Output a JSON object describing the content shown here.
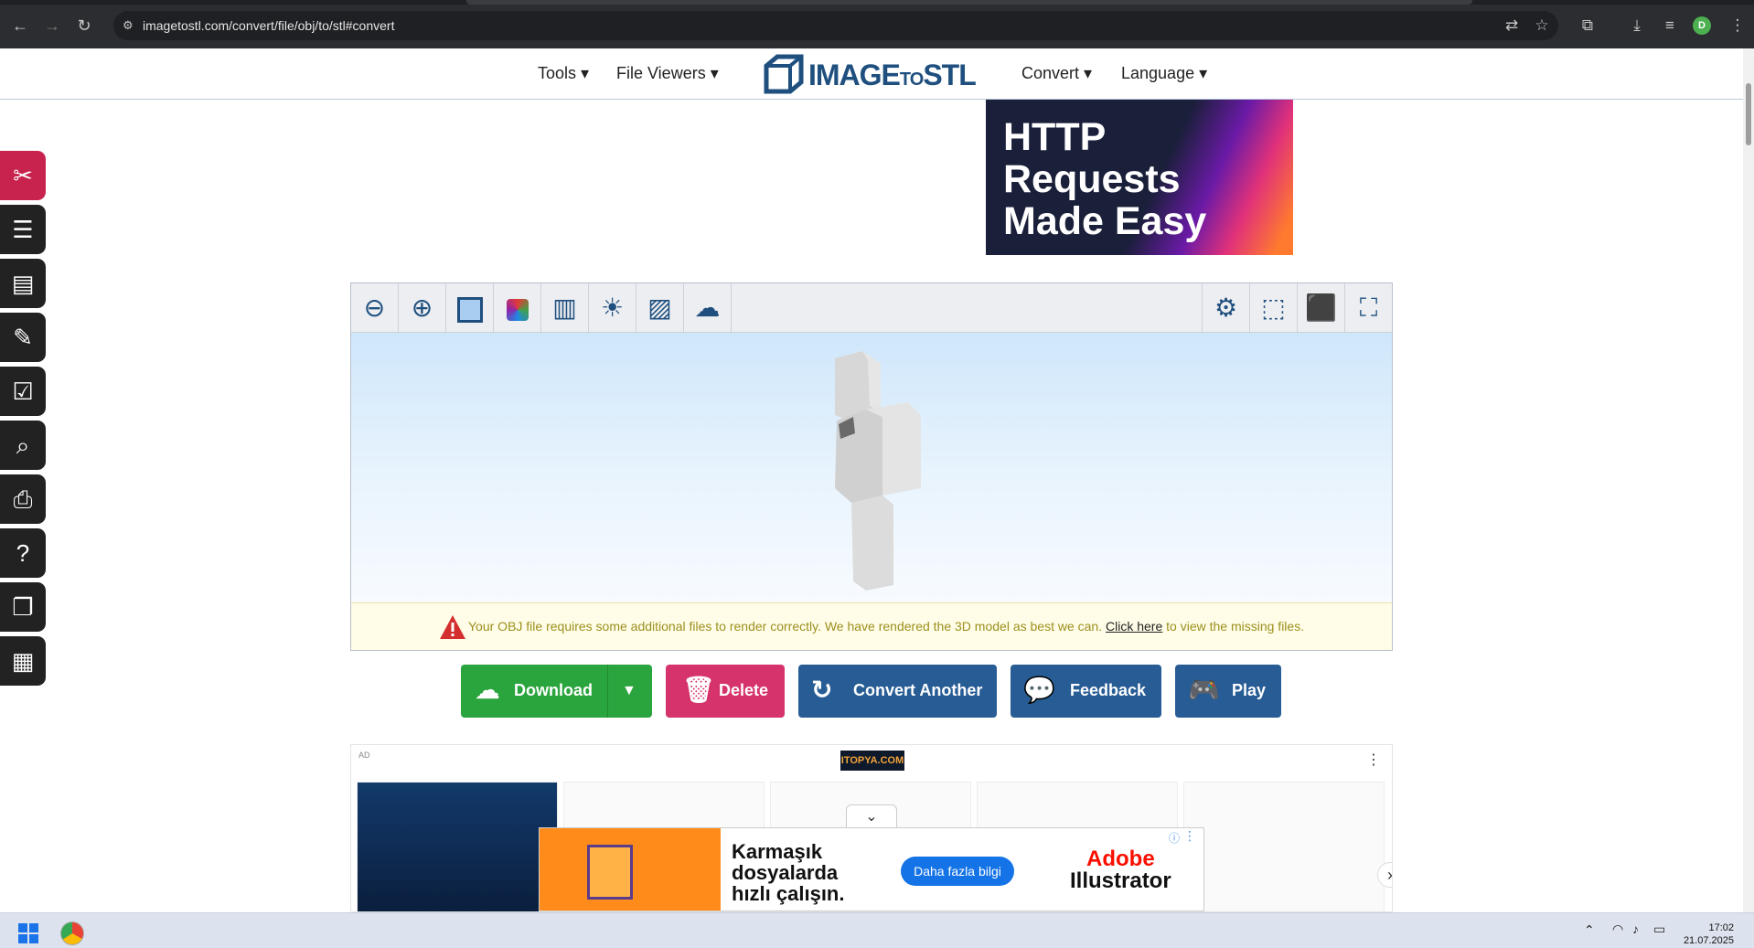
{
  "browser": {
    "url": "imagetostl.com/convert/file/obj/to/stl#convert",
    "profile_initial": "D"
  },
  "header": {
    "menu_tools": "Tools ▾",
    "menu_file_viewers": "File Viewers ▾",
    "logo_main": "IMAGE",
    "logo_small": "TO",
    "logo_end": "STL",
    "menu_convert": "Convert ▾",
    "menu_language": "Language ▾"
  },
  "hero_ad": {
    "text": "HTTP\nRequests\nMade Easy"
  },
  "viewer": {
    "warning_text": "Your OBJ file requires some additional files to render correctly. We have rendered the 3D model as best we can.",
    "warning_link": "Click here",
    "warning_tail": "to view the missing files."
  },
  "actions": {
    "download": "Download",
    "delete": "Delete",
    "convert_another": "Convert Another",
    "feedback": "Feedback",
    "play": "Play"
  },
  "ad": {
    "label": "AD",
    "brand": "ITOPYA.COM"
  },
  "overlay_ad": {
    "tagline": "Karmaşık\ndosyalarda\nhızlı çalışın.",
    "cta": "Daha fazla bilgi",
    "brand_line1": "Adobe",
    "brand_line2": "Illustrator"
  },
  "taskbar": {
    "time": "17:02",
    "date": "21.07.2025"
  },
  "colors": {
    "accent": "#1f4f7f",
    "download_green": "#2aa43d",
    "delete_red": "#d6326b",
    "action_blue": "#275c94"
  }
}
